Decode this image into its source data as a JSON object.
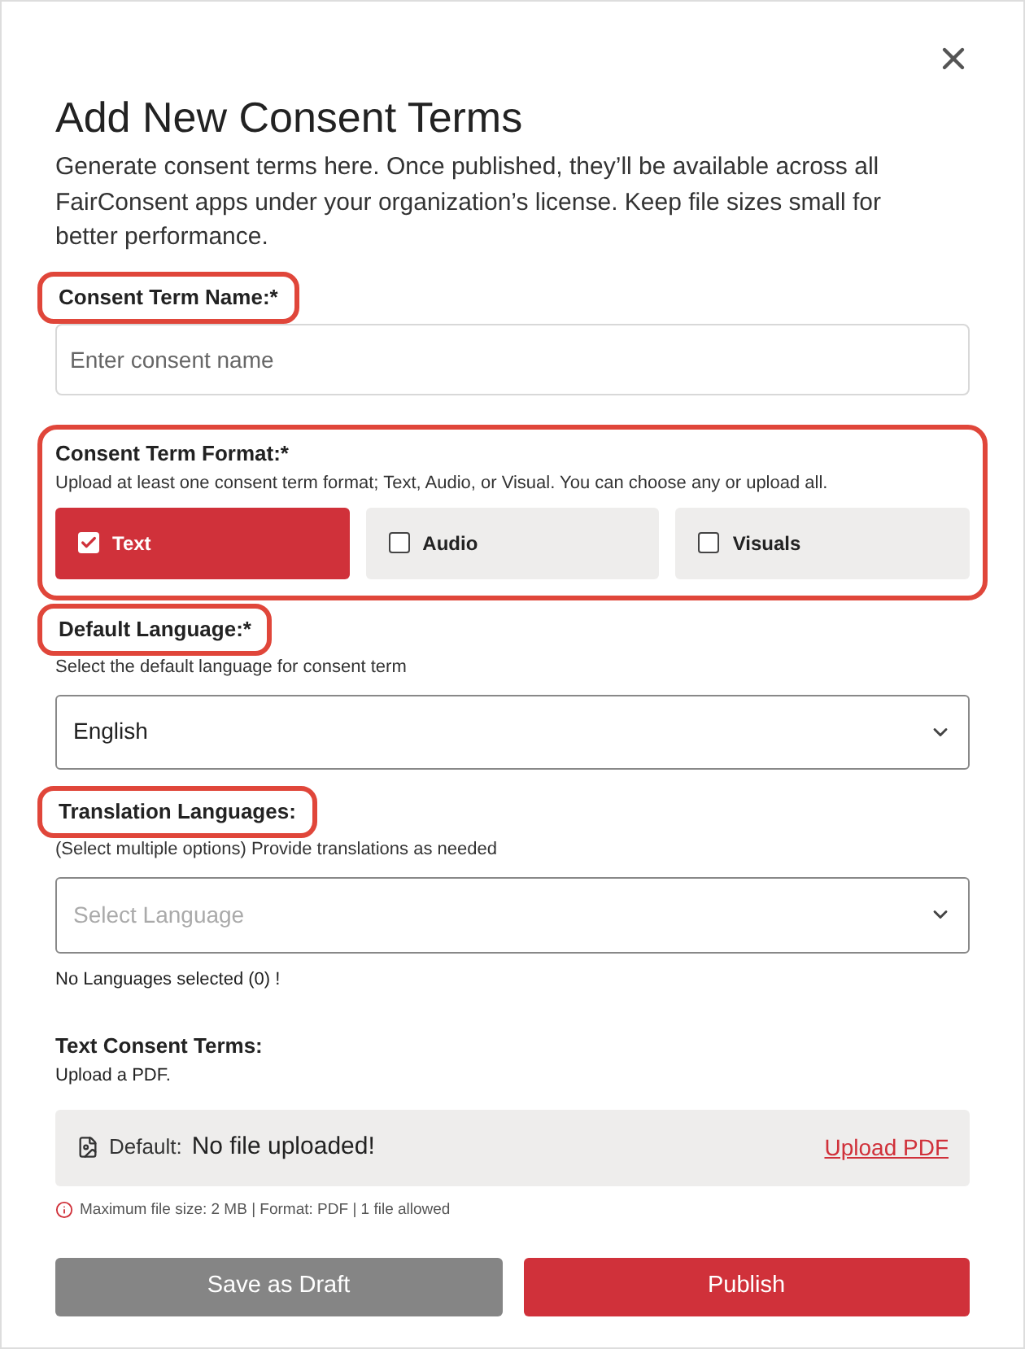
{
  "dialog": {
    "title": "Add New Consent Terms",
    "description": "Generate consent terms here. Once published, they’ll be available across all FairConsent apps under your organization’s license. Keep file sizes small for better performance."
  },
  "name_field": {
    "label": "Consent Term Name:*",
    "highlighted": true,
    "placeholder": "Enter consent name"
  },
  "format": {
    "label": "Consent Term Format:*",
    "highlighted": true,
    "hint": "Upload at least one consent term format; Text, Audio, or Visual. You can choose any or upload all.",
    "options": [
      {
        "label": "Text",
        "checked": true
      },
      {
        "label": "Audio",
        "checked": false
      },
      {
        "label": "Visuals",
        "checked": false
      }
    ]
  },
  "default_language": {
    "label": "Default Language:*",
    "highlighted": true,
    "hint": "Select the default language for consent term",
    "value": "English"
  },
  "translation_languages": {
    "label": "Translation Languages:",
    "highlighted": true,
    "hint": "(Select multiple options) Provide translations as needed",
    "placeholder": "Select Language",
    "status": "No Languages selected (0) !"
  },
  "text_terms": {
    "label": "Text Consent Terms:",
    "hint": "Upload a PDF.",
    "file_label": "Default:",
    "file_status": "No file uploaded!",
    "upload_link": "Upload PDF",
    "limits": "Maximum file size: 2 MB | Format: PDF | 1 file allowed"
  },
  "buttons": [
    {
      "label": "Save as Draft",
      "kind": "secondary"
    },
    {
      "label": "Publish",
      "kind": "primary"
    }
  ]
}
